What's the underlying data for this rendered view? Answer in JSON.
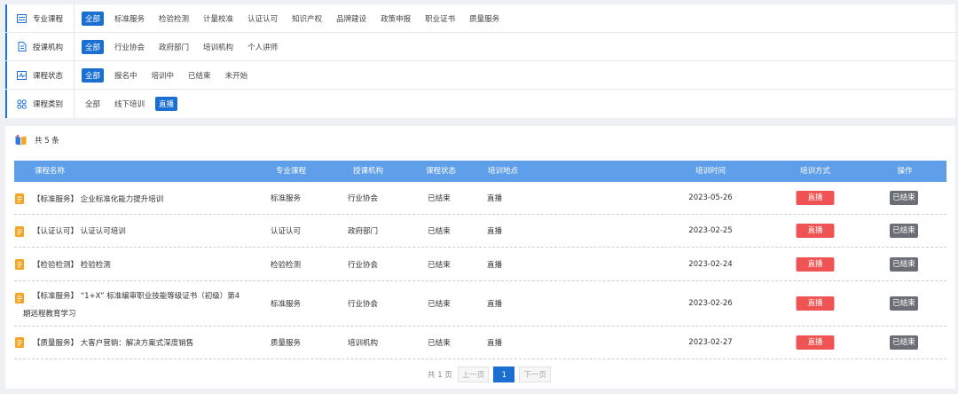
{
  "filters": [
    {
      "label": "专业课程",
      "icon": "list-icon",
      "options": [
        "全部",
        "标准服务",
        "检验检测",
        "计量校准",
        "认证认可",
        "知识产权",
        "品牌建设",
        "政策申报",
        "职业证书",
        "质量服务"
      ],
      "active": 0
    },
    {
      "label": "授课机构",
      "icon": "document-icon",
      "options": [
        "全部",
        "行业协会",
        "政府部门",
        "培训机构",
        "个人讲师"
      ],
      "active": 0
    },
    {
      "label": "课程状态",
      "icon": "pulse-icon",
      "options": [
        "全部",
        "报名中",
        "培训中",
        "已结束",
        "未开始"
      ],
      "active": 0
    },
    {
      "label": "课程类别",
      "icon": "grid-icon",
      "options": [
        "全部",
        "线下培训",
        "直播"
      ],
      "active": 2
    }
  ],
  "summary": {
    "text": "共 5 条"
  },
  "table": {
    "headers": [
      "课程名称",
      "专业课程",
      "授课机构",
      "课程状态",
      "培训地点",
      "培训时间",
      "培训方式",
      "操作"
    ],
    "rows": [
      {
        "title": "【标准服务】 企业标准化能力提升培训",
        "category": "标准服务",
        "org": "行业协会",
        "status": "已结束",
        "location": "直播",
        "date": "2023-05-26",
        "mode": "直播",
        "action": "已结束"
      },
      {
        "title": "【认证认可】 认证认可培训",
        "category": "认证认可",
        "org": "政府部门",
        "status": "已结束",
        "location": "直播",
        "date": "2023-02-25",
        "mode": "直播",
        "action": "已结束"
      },
      {
        "title": "【检验检测】 检验检测",
        "category": "检验检测",
        "org": "行业协会",
        "status": "已结束",
        "location": "直播",
        "date": "2023-02-24",
        "mode": "直播",
        "action": "已结束"
      },
      {
        "title": "【标准服务】 “1+X” 标准编审职业技能等级证书（初级）第4期远程教育学习",
        "category": "标准服务",
        "org": "行业协会",
        "status": "已结束",
        "location": "直播",
        "date": "2023-02-26",
        "mode": "直播",
        "action": "已结束"
      },
      {
        "title": "【质量服务】 大客户营销：解决方案式深度销售",
        "category": "质量服务",
        "org": "培训机构",
        "status": "已结束",
        "location": "直播",
        "date": "2023-02-27",
        "mode": "直播",
        "action": "已结束"
      }
    ]
  },
  "pagination": {
    "total": "共 1 页",
    "prev": "上一页",
    "current": "1",
    "next": "下一页"
  },
  "colors": {
    "accent": "#1a6fd1",
    "header": "#5f9ee8",
    "live": "#f05353",
    "ended": "#6b6f75",
    "doc": "#f4a623"
  }
}
